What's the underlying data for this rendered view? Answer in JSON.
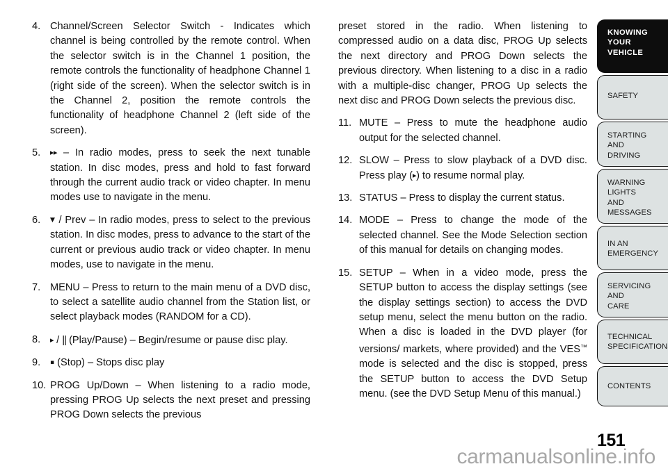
{
  "page": {
    "number": "151",
    "watermark": "carmanualsonline.info"
  },
  "left_column": {
    "items": [
      {
        "number": "4.",
        "text": "Channel/Screen Selector Switch - Indicates which channel is being controlled by the remote control. When the selector switch is in the Channel 1 position, the remote controls the functionality of headphone Channel 1 (right side of the screen). When the selector switch is in the Channel 2, position the remote controls the functionality of headphone Channel 2 (left side of the screen)."
      },
      {
        "number": "5.",
        "symbol": "▸▸",
        "text": "– In radio modes, press to seek the next tunable station. In disc modes, press and hold to fast forward through the current audio track or video chapter. In menu modes use to navigate in the menu."
      },
      {
        "number": "6.",
        "symbol": "▼",
        "text": "/ Prev – In radio modes, press to select to the previous station. In disc modes, press to advance to the start of the current or previous audio track or video chapter. In menu modes, use to navigate in the menu."
      },
      {
        "number": "7.",
        "text": "MENU – Press to return to the main menu of a DVD disc, to select a satellite audio channel from the Station list, or select playback modes (RANDOM for a CD)."
      },
      {
        "number": "8.",
        "symbol": "▸",
        "symbol2": "||",
        "text": "(Play/Pause) – Begin/resume or pause disc play."
      },
      {
        "number": "9.",
        "symbol": "▪",
        "text": "(Stop) – Stops disc play"
      },
      {
        "number": "10.",
        "text": "PROG Up/Down – When listening to a radio mode, pressing PROG Up selects the next preset and pressing PROG Down selects the previous"
      }
    ]
  },
  "right_column": {
    "continuation": "preset stored in the radio. When listening to compressed audio on a data disc, PROG Up selects the next directory and PROG Down selects the previous directory. When listening to a disc in a radio with a multiple-disc changer, PROG Up selects the next disc and PROG Down selects the previous disc.",
    "items": [
      {
        "number": "11.",
        "text": "MUTE – Press to mute the headphone audio output for the selected channel."
      },
      {
        "number": "12.",
        "text_before": "SLOW – Press to slow playback of a DVD disc. Press play (",
        "symbol": "▸",
        "text_after": ") to resume normal play."
      },
      {
        "number": "13.",
        "text": "STATUS – Press to display the current status."
      },
      {
        "number": "14.",
        "text": "MODE – Press to change the mode of the selected channel. See the Mode Selection section of this manual for details on changing modes."
      },
      {
        "number": "15.",
        "text_before": "SETUP – When in a video mode, press the SETUP button to access the display settings (see the display settings section) to access the DVD setup menu, select the menu button on the radio. When a disc is loaded in the DVD player (for versions/ markets, where provided) and the VES",
        "symbol": "™",
        "text_after": " mode is selected and the disc is stopped, press the SETUP button to access the DVD Setup menu. (see the DVD Setup Menu of this manual.)"
      }
    ]
  },
  "tabs": [
    {
      "lines": [
        "KNOWING",
        "YOUR",
        "VEHICLE"
      ],
      "active": true
    },
    {
      "lines": [
        "SAFETY"
      ],
      "active": false
    },
    {
      "lines": [
        "STARTING",
        "AND",
        "DRIVING"
      ],
      "active": false
    },
    {
      "lines": [
        "WARNING",
        "LIGHTS",
        "AND",
        "MESSAGES"
      ],
      "active": false
    },
    {
      "lines": [
        "IN AN",
        "EMERGENCY"
      ],
      "active": false
    },
    {
      "lines": [
        "SERVICING",
        "AND",
        "CARE"
      ],
      "active": false
    },
    {
      "lines": [
        "TECHNICAL",
        "SPECIFICATIONS"
      ],
      "active": false
    },
    {
      "lines": [
        "CONTENTS"
      ],
      "active": false
    }
  ]
}
